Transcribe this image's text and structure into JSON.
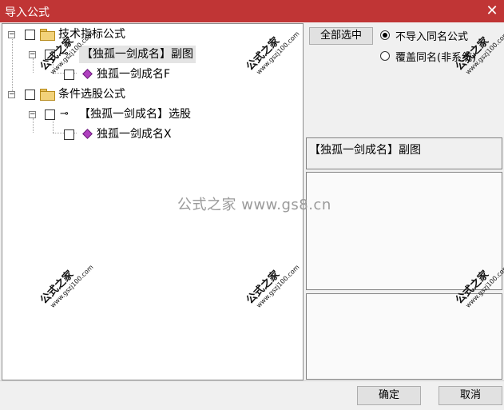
{
  "window": {
    "title": "导入公式",
    "close_glyph": "✕"
  },
  "tree": {
    "items": [
      {
        "label": "技术指标公式",
        "icon": "folder-icon",
        "expander": "−"
      },
      {
        "label": "【独孤一剑成名】副图",
        "icon": "key-icon",
        "expander": "−"
      },
      {
        "label": "独孤一剑成名F",
        "icon": "gem-icon"
      },
      {
        "label": "条件选股公式",
        "icon": "folder-icon",
        "expander": "−"
      },
      {
        "label": "【独孤一剑成名】选股",
        "icon": "key-icon",
        "expander": "−"
      },
      {
        "label": "独孤一剑成名X",
        "icon": "gem-icon"
      }
    ]
  },
  "right": {
    "select_all_label": "全部选中",
    "radio_options": [
      {
        "label": "不导入同名公式",
        "selected": true
      },
      {
        "label": "覆盖同名(非系统)",
        "selected": false
      }
    ],
    "selected_name": "【独孤一剑成名】副图"
  },
  "footer": {
    "ok_label": "确定",
    "cancel_label": "取消"
  },
  "watermarks": {
    "center": "公式之家 www.gs8.cn",
    "stamp_text": "公式之家",
    "stamp_url": "www.gszj100.com"
  },
  "colors": {
    "titlebar": "#c03535",
    "gem": "#b040c0",
    "folder": "#f2d27a"
  }
}
